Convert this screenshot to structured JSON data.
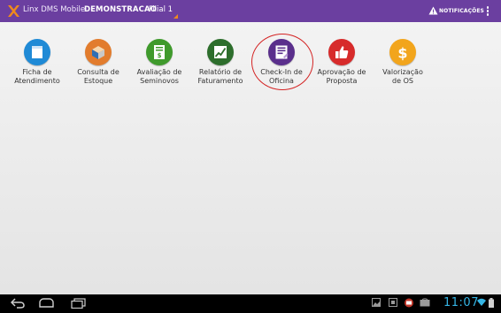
{
  "header": {
    "app_title": "Linx DMS Mobile",
    "company": "DEMONSTRACAO",
    "branch": "Filial 1",
    "notifications_label": "NOTIFICAÇÕES",
    "bar_color": "#6b3fa0",
    "accent_color": "#f08a1c"
  },
  "tiles": [
    {
      "label": "Ficha de\nAtendimento",
      "icon": "form-icon",
      "color": "#1f8ad6"
    },
    {
      "label": "Consulta de\nEstoque",
      "icon": "box-icon",
      "color": "#e27c2d"
    },
    {
      "label": "Avaliação de\nSeminovos",
      "icon": "dollar-document-icon",
      "color": "#3f9a2c"
    },
    {
      "label": "Relatório de\nFaturamento",
      "icon": "chart-icon",
      "color": "#2d6e2c"
    },
    {
      "label": "Check-In de\nOficina",
      "icon": "checklist-icon",
      "color": "#5a2f8c"
    },
    {
      "label": "Aprovação de\nProposta",
      "icon": "thumbs-up-icon",
      "color": "#d72b2b"
    },
    {
      "label": "Valorização\nde OS",
      "icon": "dollar-icon",
      "color": "#f2a51c"
    }
  ],
  "status_bar": {
    "time": "11:07",
    "clock_color": "#35b5e5"
  }
}
